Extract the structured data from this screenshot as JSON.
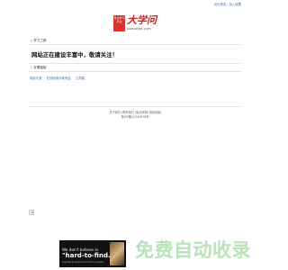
{
  "header": {
    "links": [
      "设为首页",
      "加入收藏"
    ]
  },
  "logo": {
    "seal_text": "专业学习平台",
    "name": "大学问",
    "domain": "Daxuewt.com"
  },
  "sections": {
    "study_tools": "学习工具",
    "friend_links": "友情链接"
  },
  "notice": "网站正在建设丰富中，敬请关注！",
  "friend_links": [
    "电影天堂",
    "在线阅读开卷有益",
    "工具箱"
  ],
  "footer": {
    "links": [
      "关于我们",
      "联系我们",
      "免责声明",
      "网站地图"
    ],
    "icp": "豫ICP备12345678号"
  },
  "side_button": "◄",
  "ad": {
    "line1": "We don't believe in",
    "line2": "\"hard-to-find.\"",
    "line3": "Supplies & Solutions for Every Industry"
  },
  "watermark": "免费自动收录",
  "colors": {
    "link": "#3b6fb6",
    "brand_red": "#c0241e",
    "watermark": "#b9e3b9"
  }
}
